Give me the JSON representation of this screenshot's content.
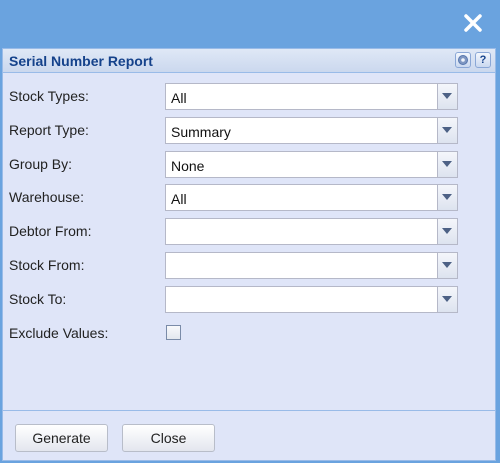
{
  "window": {
    "close_icon": "close-icon"
  },
  "panel": {
    "title": "Serial Number Report",
    "tools": [
      {
        "icon": "gear-icon"
      },
      {
        "icon": "help-icon",
        "glyph": "?"
      }
    ]
  },
  "form": {
    "fields": [
      {
        "label": "Stock Types:",
        "value": "All"
      },
      {
        "label": "Report Type:",
        "value": "Summary"
      },
      {
        "label": "Group By:",
        "value": "None"
      },
      {
        "label": "Warehouse:",
        "value": "All"
      },
      {
        "label": "Debtor From:",
        "value": ""
      },
      {
        "label": "Stock From:",
        "value": ""
      },
      {
        "label": "Stock To:",
        "value": ""
      }
    ],
    "exclude_values": {
      "label": "Exclude Values:",
      "checked": false
    }
  },
  "footer": {
    "generate_label": "Generate",
    "close_label": "Close"
  },
  "colors": {
    "titlebar": "#6aa3df",
    "panel_bg": "#dfe5f8",
    "title_text": "#15428b"
  }
}
